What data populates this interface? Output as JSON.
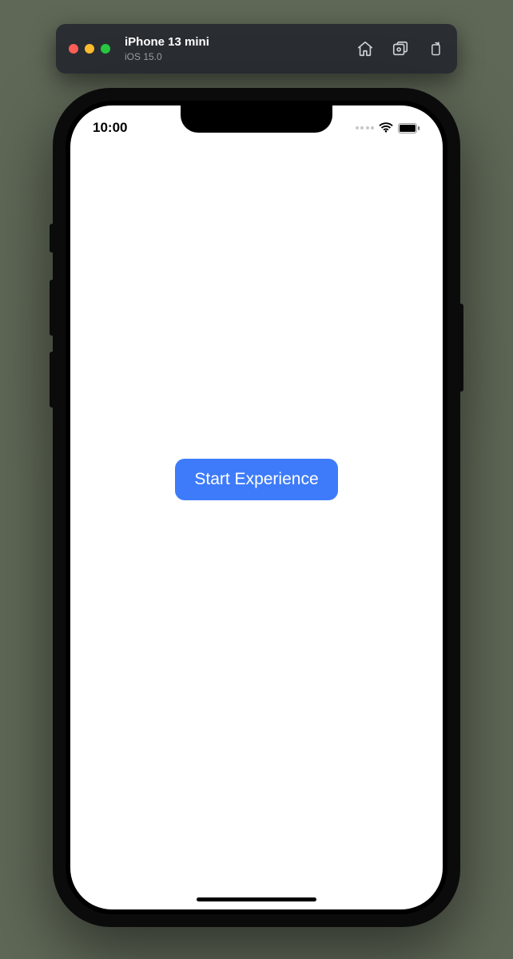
{
  "simulator": {
    "device_name": "iPhone 13 mini",
    "os_version": "iOS 15.0",
    "actions": {
      "home": "home-icon",
      "screenshot": "screenshot-icon",
      "rotate": "rotate-icon"
    }
  },
  "status_bar": {
    "time": "10:00"
  },
  "app": {
    "primary_button_label": "Start Experience"
  },
  "colors": {
    "accent": "#3e7bfa",
    "toolbar_bg": "#2a2e33",
    "page_bg": "#5f6857"
  }
}
